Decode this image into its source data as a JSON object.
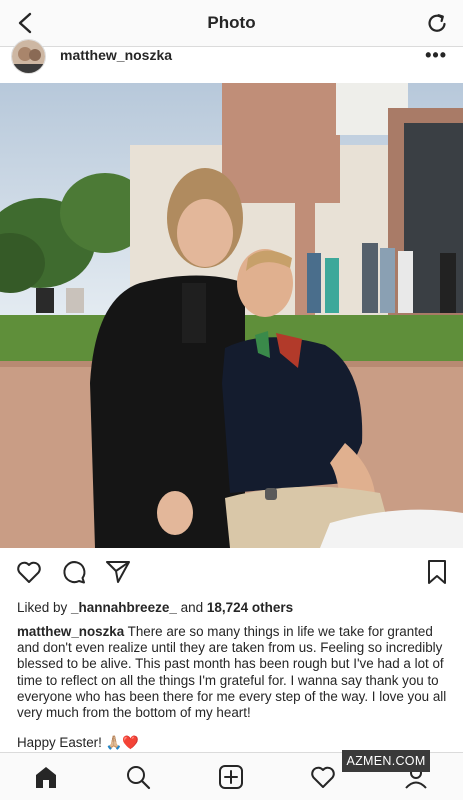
{
  "header": {
    "title": "Photo",
    "back_icon": "chevron-left-icon",
    "refresh_icon": "refresh-icon"
  },
  "post": {
    "username": "matthew_noszka",
    "more_label": "•••",
    "likes_prefix": "Liked by ",
    "likes_user": "_hannahbreeze_",
    "likes_and": " and ",
    "likes_count": "18,724 others",
    "caption_user": "matthew_noszka",
    "caption_text": " There are so many things in life we take for granted and don't even realize until they are taken from us. Feeling so incredibly blessed to be alive. This past month has been rough but I've had a lot of time to reflect on all the things I'm grateful for. I wanna say thank you to everyone who has been there for me every step of the way. I love you all very much from the bottom of my heart!",
    "easter_text": "Happy Easter!",
    "easter_emoji": "🙏🏼❤️"
  },
  "bottom_nav": [
    "home-icon",
    "search-icon",
    "new-post-icon",
    "activity-heart-icon",
    "profile-icon"
  ],
  "watermark": "AZMEN.COM",
  "colors": {
    "text": "#262626",
    "bar": "#fafafa",
    "divider": "#dbdbdb",
    "sky": "#c9d6e3",
    "grass": "#5f8f3a",
    "wall": "#c8a08a"
  }
}
